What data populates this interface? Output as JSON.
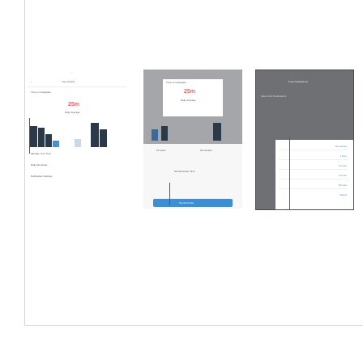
{
  "phone1": {
    "title": "Your Activity",
    "section": "Time on Instagram",
    "value": "25m",
    "subtitle": "Daily Average",
    "manage": "Manage Your Time",
    "row1": "Daily Reminder",
    "row2": "Notification Settings"
  },
  "phone2": {
    "title": "Your Activity",
    "section": "Time on Instagram",
    "value": "25m",
    "subtitle": "Daily Average",
    "picker_left": "15 hours",
    "picker_right": "30 minutes",
    "picker_label": "Set Reminder Time",
    "button": "Set Reminder"
  },
  "phone3": {
    "title": "Push Notifications",
    "row1": "Mute Push Notifications",
    "options": [
      "15 minutes",
      "1 hour",
      "2 hours",
      "4 hours",
      "8 hours",
      "Cancel"
    ]
  },
  "colors": {
    "accent": "#3a8fd8",
    "bar": "#2b3a4a"
  }
}
